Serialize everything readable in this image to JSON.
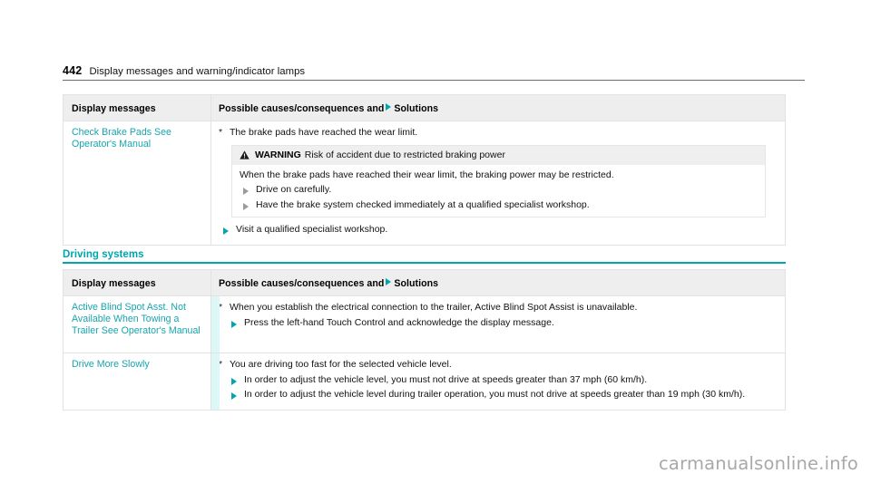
{
  "header": {
    "page_number": "442",
    "title": "Display messages and warning/indicator lamps"
  },
  "colors": {
    "accent_teal": "#00a5ad",
    "link_teal": "#17a5ad",
    "header_band": "#eeeeee",
    "warn_band": "#efefef",
    "stripe_cyan": "#ddf6f7",
    "border": "#e2e2e2"
  },
  "table_header": {
    "col1": "Display messages",
    "col2_pre": "Possible causes/consequences and",
    "col2_post": "Solutions",
    "marker_icon": "triangle-right-icon"
  },
  "tables": [
    {
      "section_title": null,
      "rows": [
        {
          "message": "Check Brake Pads See Operator's Manual",
          "cause": "The brake pads have reached the wear limit.",
          "warning": {
            "icon": "warning-triangle-icon",
            "label": "WARNING",
            "title": "Risk of accident due to restricted braking power",
            "body": "When the brake pads have reached their wear limit, the braking power may be restricted.",
            "steps": [
              "Drive on carefully.",
              "Have the brake system checked immediately at a qualified specialist workshop."
            ]
          },
          "steps": [
            "Visit a qualified specialist workshop."
          ]
        }
      ]
    },
    {
      "section_title": "Driving systems",
      "rows": [
        {
          "message": "Active Blind Spot Asst. Not Available When Towing a Trailer See Operator's Manual",
          "cause": "When you establish the electrical connection to the trailer, Active Blind Spot Assist is unavailable.",
          "warning": null,
          "steps": [
            "Press the left-hand Touch Control and acknowledge the display message."
          ]
        },
        {
          "message": "Drive More Slowly",
          "cause": "You are driving too fast for the selected vehicle level.",
          "warning": null,
          "steps": [
            "In order to adjust the vehicle level, you must not drive at speeds greater than 37 mph (60 km/h).",
            "In order to adjust the vehicle level during trailer operation, you must not drive at speeds greater than 19 mph (30 km/h)."
          ]
        }
      ]
    }
  ],
  "watermark": "carmanualsonline.info"
}
